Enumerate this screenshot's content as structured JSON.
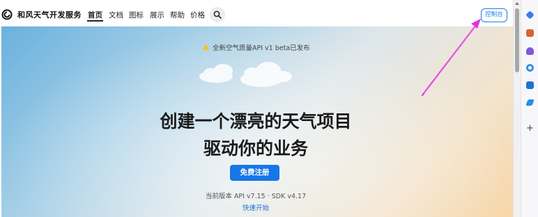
{
  "header": {
    "brand": "和风天气开发服务",
    "nav": [
      {
        "label": "首页",
        "active": true
      },
      {
        "label": "文档",
        "active": false
      },
      {
        "label": "图标",
        "active": false
      },
      {
        "label": "展示",
        "active": false
      },
      {
        "label": "帮助",
        "active": false
      },
      {
        "label": "价格",
        "active": false
      }
    ],
    "search_icon": "search-icon",
    "console_label": "控制台"
  },
  "hero": {
    "announcement": "全新空气质量API v1 beta已发布",
    "headline_line1": "创建一个漂亮的天气项目",
    "headline_line2": "驱动你的业务",
    "signup_label": "免费注册",
    "version_text": "当前版本 API v7.15 · SDK v4.17",
    "quickstart_label": "快速开始"
  },
  "colors": {
    "accent": "#1677e8",
    "annotation_arrow": "#e62ee0"
  },
  "sidepanel": {
    "icons": [
      "tag-icon",
      "toolbox-icon",
      "people-icon",
      "circle-app-icon",
      "outlook-icon",
      "pen-icon"
    ],
    "add_label": "+"
  }
}
